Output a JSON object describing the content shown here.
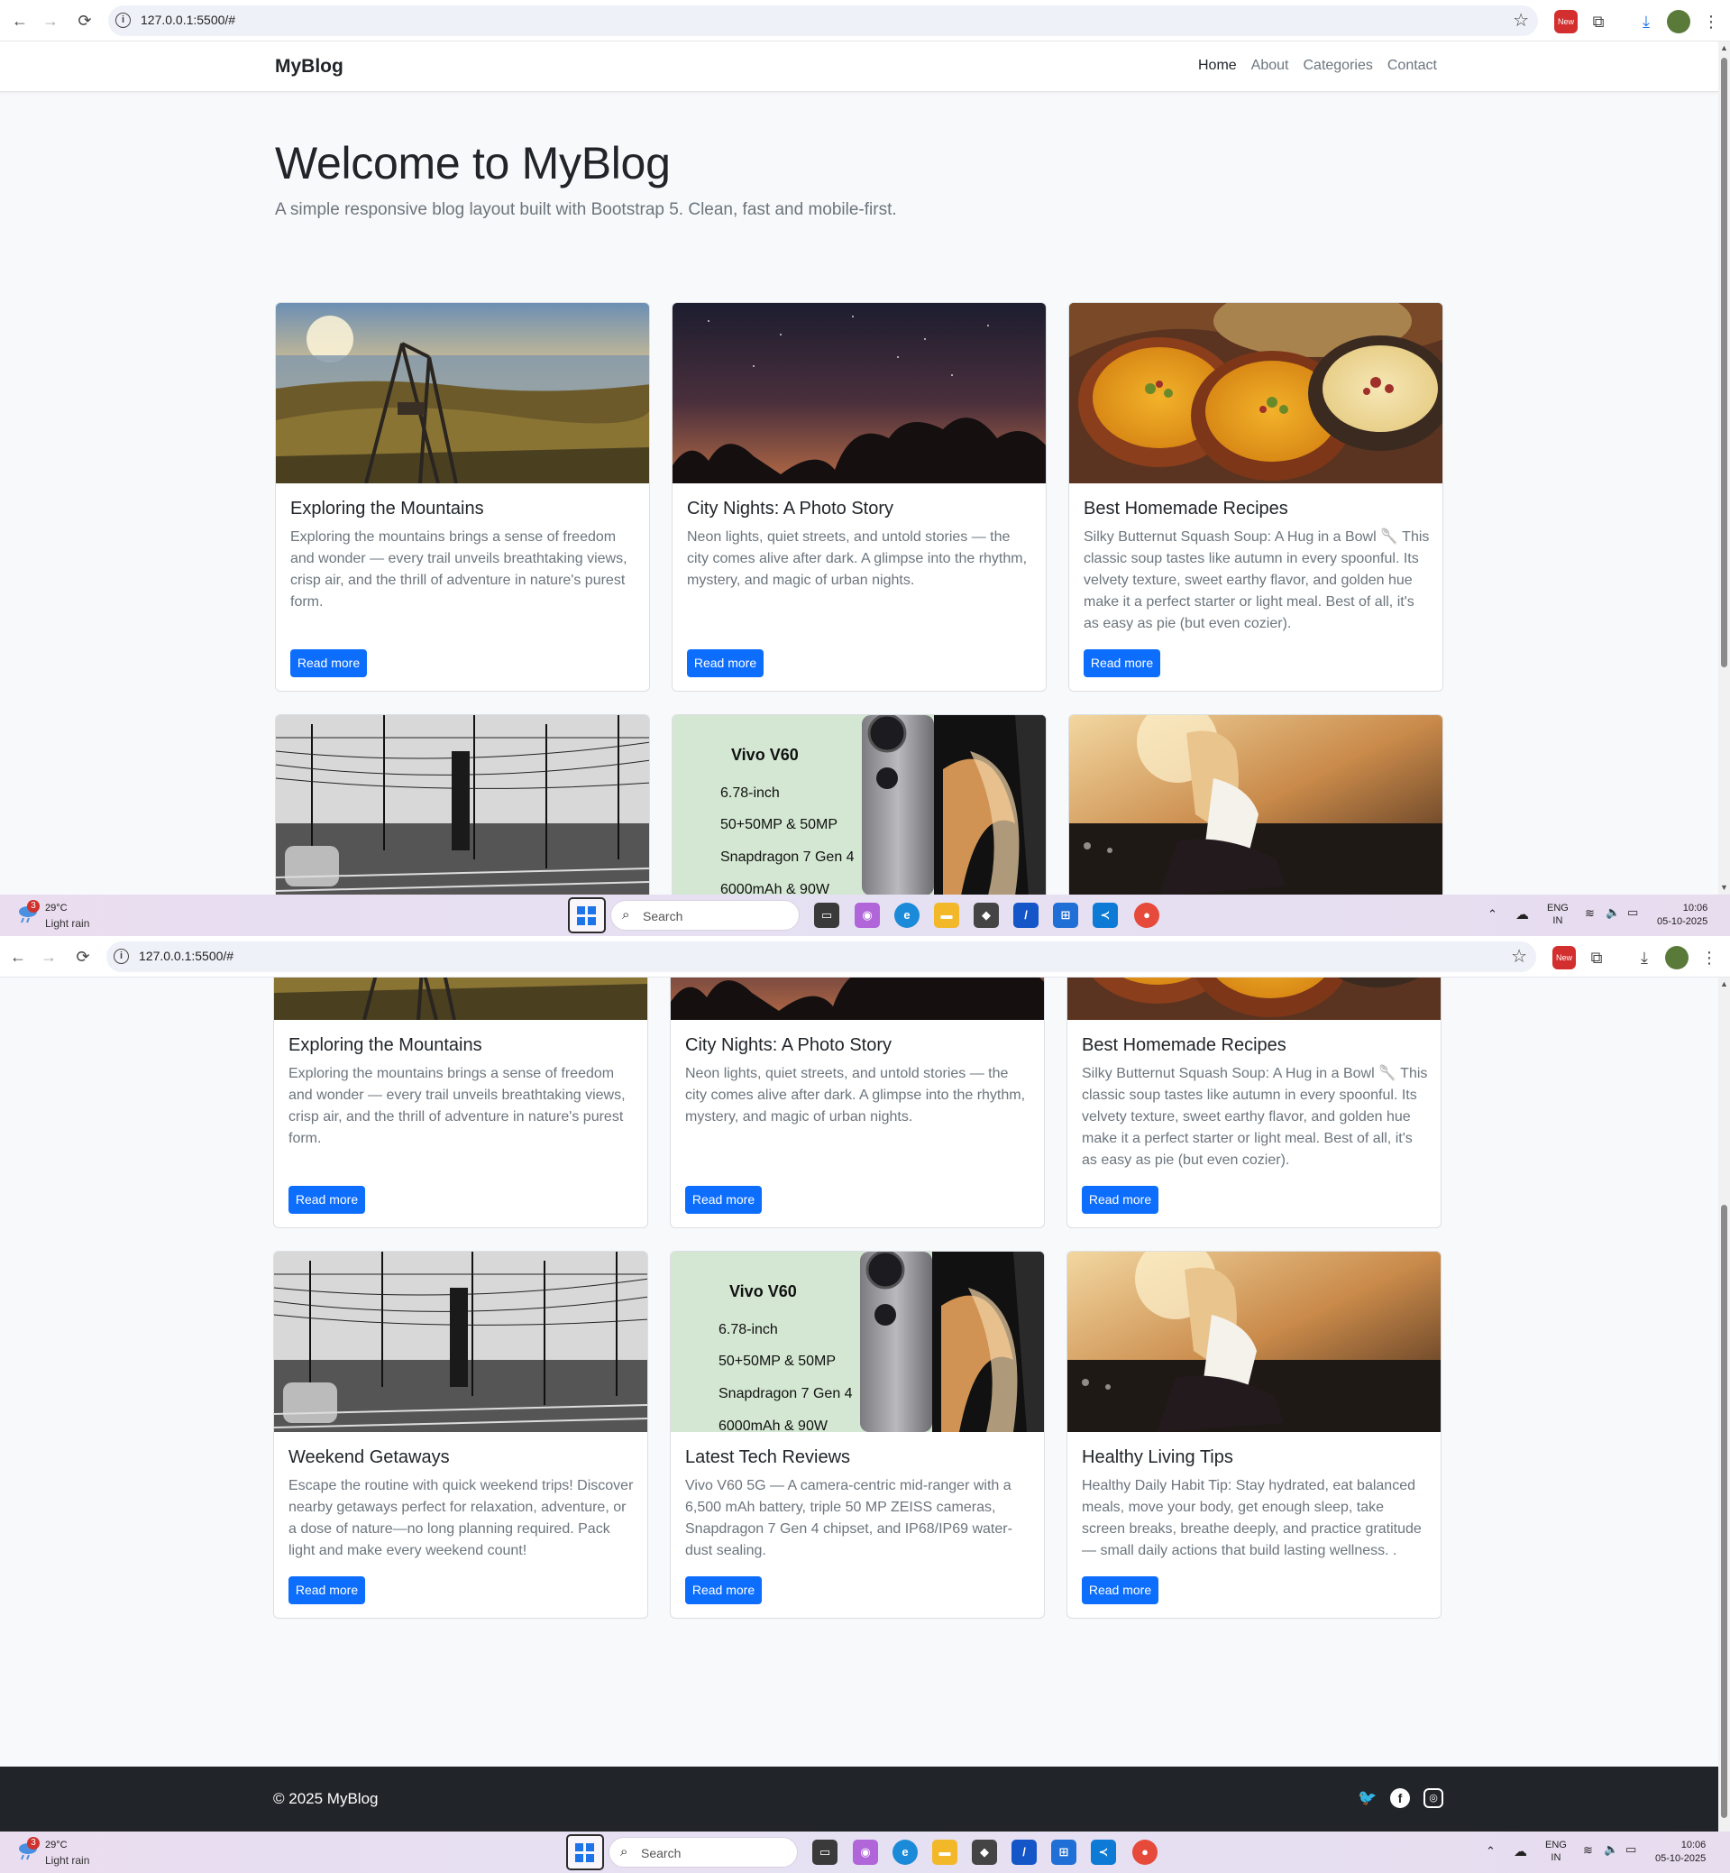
{
  "browser": {
    "url": "127.0.0.1:5500/#",
    "ext_badge": "New"
  },
  "site": {
    "brand": "MyBlog",
    "nav": [
      "Home",
      "About",
      "Categories",
      "Contact"
    ],
    "active_nav": "Home",
    "hero_title": "Welcome to MyBlog",
    "hero_subtitle": "A simple responsive blog layout built with Bootstrap 5. Clean, fast and mobile-first.",
    "read_more": "Read more",
    "footer_copy": "© 2025 MyBlog"
  },
  "posts": [
    {
      "title": "Exploring the Mountains",
      "text": "Exploring the mountains brings a sense of freedom and wonder — every trail unveils breathtaking views, crisp air, and the thrill of adventure in nature's purest form.",
      "image": "lakeside-swing-sunset"
    },
    {
      "title": "City Nights: A Photo Story",
      "text": "Neon lights, quiet streets, and untold stories — the city comes alive after dark. A glimpse into the rhythm, mystery, and magic of urban nights.",
      "image": "starry-night-sky"
    },
    {
      "title": "Best Homemade Recipes",
      "text": "Silky Butternut Squash Soup: A Hug in a Bowl 🥄 This classic soup tastes like autumn in every spoonful. Its velvety texture, sweet earthy flavor, and golden hue make it a perfect starter or light meal. Best of all, it's as easy as pie (but even cozier).",
      "image": "soup-bowls"
    },
    {
      "title": "Weekend Getaways",
      "text": "Escape the routine with quick weekend trips! Discover nearby getaways perfect for relaxation, adventure, or a dose of nature—no long planning required. Pack light and make every weekend count!",
      "image": "railway-lines-bw"
    },
    {
      "title": "Latest Tech Reviews",
      "text": "Vivo V60 5G — A camera-centric mid-ranger with a 6,500 mAh battery, triple 50 MP ZEISS cameras, Snapdragon 7 Gen 4 chipset, and IP68/IP69 water-dust sealing.",
      "image": "vivo-v60-promo",
      "promo": {
        "name": "Vivo V60",
        "specs": [
          "6.78-inch",
          "50+50MP & 50MP",
          "Snapdragon 7 Gen 4",
          "6000mAh & 90W"
        ]
      }
    },
    {
      "title": "Healthy Living Tips",
      "text": "Healthy Daily Habit Tip: Stay hydrated, eat balanced meals, move your body, get enough sleep, take screen breaks, breathe deeply, and practice gratitude — small daily actions that build lasting wellness. .",
      "image": "woman-lakeside-sunlight"
    }
  ],
  "taskbar": {
    "weather_badge": "3",
    "temp": "29°C",
    "weather": "Light rain",
    "search": "Search",
    "lang_1": "ENG",
    "lang_2": "IN",
    "time": "10:06",
    "date": "05-10-2025"
  },
  "colors": {
    "primary": "#0d6efd",
    "page_bg": "#f8f9fa",
    "footer_bg": "#212529"
  }
}
